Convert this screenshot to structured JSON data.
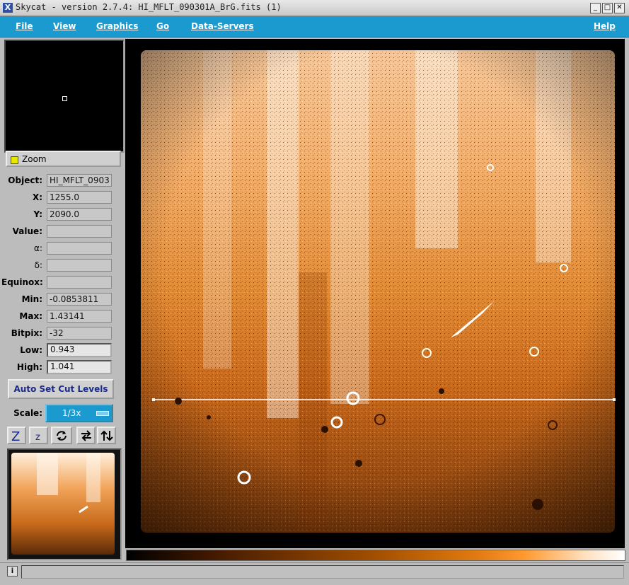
{
  "window": {
    "title": "Skycat - version 2.7.4: HI_MFLT_090301A_BrG.fits (1)",
    "icon": "x-app-icon",
    "controls": [
      "minimize-icon",
      "maximize-icon",
      "close-icon"
    ]
  },
  "menu": {
    "file": "File",
    "view": "View",
    "graphics": "Graphics",
    "go": "Go",
    "data_servers": "Data-Servers",
    "help": "Help"
  },
  "panel": {
    "zoom_label": "Zoom",
    "fields": {
      "object": {
        "label": "Object:",
        "value": "HI_MFLT_0903"
      },
      "x": {
        "label": "X:",
        "value": "1255.0"
      },
      "y": {
        "label": "Y:",
        "value": "2090.0"
      },
      "value": {
        "label": "Value:",
        "value": ""
      },
      "alpha": {
        "label": "α:",
        "value": ""
      },
      "delta": {
        "label": "δ:",
        "value": ""
      },
      "equinox": {
        "label": "Equinox:",
        "value": ""
      },
      "min": {
        "label": "Min:",
        "value": "-0.0853811"
      },
      "max": {
        "label": "Max:",
        "value": "1.43141"
      },
      "bitpix": {
        "label": "Bitpix:",
        "value": "-32"
      },
      "low": {
        "label": "Low:",
        "value": "0.943"
      },
      "high": {
        "label": "High:",
        "value": "1.041"
      }
    },
    "auto_set_label": "Auto Set Cut Levels",
    "scale_label": "Scale:",
    "scale_value": "1/3x",
    "tools": [
      "zoom-in-icon",
      "zoom-out-icon",
      "rotate-icon",
      "flip-x-icon",
      "flip-y-icon"
    ]
  },
  "colors": {
    "accent": "#1b9ad0",
    "image_tint": "#e07a10"
  },
  "status": {
    "info_icon": "info-icon",
    "message": ""
  }
}
